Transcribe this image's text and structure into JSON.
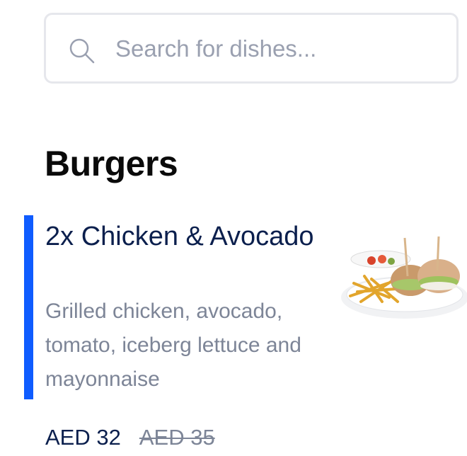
{
  "search": {
    "placeholder": "Search for dishes...",
    "value": "",
    "icon": "search-icon"
  },
  "section": {
    "title": "Burgers"
  },
  "dish": {
    "name": "2x Chicken & Avocado",
    "description": "Grilled chicken, avocado, tomato, iceberg lettuce and mayonnaise",
    "price": "AED 32",
    "old_price": "AED 35",
    "accent_color": "#0f5cff"
  }
}
